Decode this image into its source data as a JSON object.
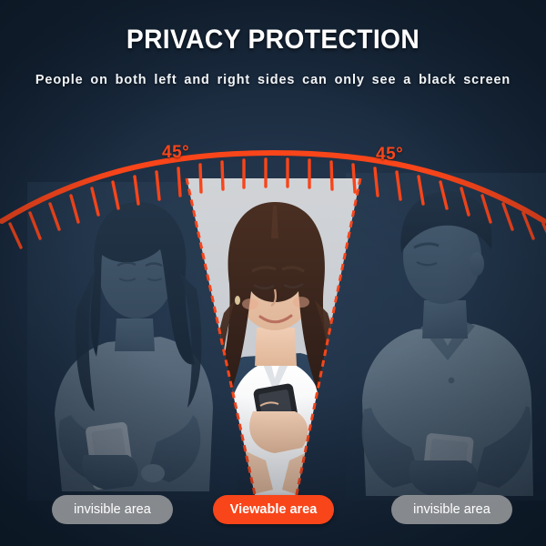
{
  "header": {
    "title": "PRIVACY PROTECTION",
    "subtitle": "People on both left and right sides can only see a black screen"
  },
  "angles": {
    "left_label": "45°",
    "right_label": "45°"
  },
  "badges": {
    "left": "invisible area",
    "center": "Viewable area",
    "right": "invisible area"
  },
  "colors": {
    "accent_orange": "#F8451A",
    "background_navy": "#1a2b3f",
    "badge_gray": "#96989B",
    "cone_fill": "#d2d4d7",
    "text_white": "#FFFFFF"
  },
  "figures": {
    "left": "woman-using-phone-dimmed",
    "center": "woman-using-phone-visible",
    "right": "man-using-phone-dimmed"
  },
  "icons": {
    "arc": "protractor-arc-icon",
    "cone": "viewing-cone-icon",
    "phone": "smartphone-icon"
  }
}
